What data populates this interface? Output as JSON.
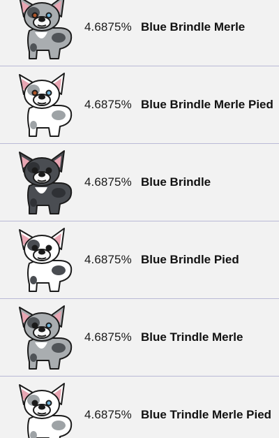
{
  "rows": [
    {
      "percent": "4.6875%",
      "name": "Blue Brindle Merle",
      "icon": "french-bulldog-blue-brindle-merle",
      "coat": "#a9adb0",
      "patch": "#4f5357",
      "chest": "#ffffff",
      "eyes": [
        "#b0562a",
        "#6fb3d8"
      ]
    },
    {
      "percent": "4.6875%",
      "name": "Blue Brindle Merle Pied",
      "icon": "french-bulldog-blue-brindle-merle-pied",
      "coat": "#ffffff",
      "patch": "#9ea3a6",
      "chest": "#ffffff",
      "eyes": [
        "#b0562a",
        "#6fb3d8"
      ]
    },
    {
      "percent": "4.6875%",
      "name": "Blue Brindle",
      "icon": "french-bulldog-blue-brindle",
      "coat": "#4a4d52",
      "patch": "#2f3135",
      "chest": "#ffffff",
      "eyes": [
        "#1a1a1a",
        "#1a1a1a"
      ]
    },
    {
      "percent": "4.6875%",
      "name": "Blue Brindle Pied",
      "icon": "french-bulldog-blue-brindle-pied",
      "coat": "#ffffff",
      "patch": "#4a4d52",
      "chest": "#ffffff",
      "eyes": [
        "#1a1a1a",
        "#1a1a1a"
      ]
    },
    {
      "percent": "4.6875%",
      "name": "Blue Trindle Merle",
      "icon": "french-bulldog-blue-trindle-merle",
      "coat": "#a9adb0",
      "patch": "#4f5357",
      "chest": "#ffffff",
      "eyes": [
        "#1a1a1a",
        "#6fb3d8"
      ]
    },
    {
      "percent": "4.6875%",
      "name": "Blue Trindle Merle Pied",
      "icon": "french-bulldog-blue-trindle-merle-pied",
      "coat": "#ffffff",
      "patch": "#9ea3a6",
      "chest": "#ffffff",
      "eyes": [
        "#1a1a1a",
        "#6fb3d8"
      ]
    }
  ]
}
